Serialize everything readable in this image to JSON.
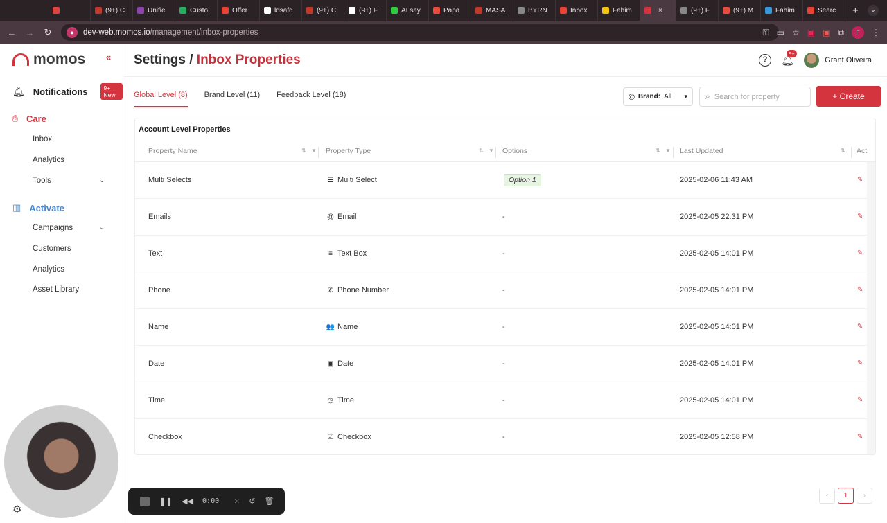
{
  "browser": {
    "tabs": [
      {
        "label": "",
        "color": "#e0443e"
      },
      {
        "label": "(9+) C",
        "color": "#c0392b"
      },
      {
        "label": "Unifie",
        "color": "#8e44ad"
      },
      {
        "label": "Custo",
        "color": "#27ae60"
      },
      {
        "label": "Offer",
        "color": "#ea4335"
      },
      {
        "label": "ldsafd",
        "color": "#ffffff"
      },
      {
        "label": "(9+) C",
        "color": "#c0392b"
      },
      {
        "label": "(9+) F",
        "color": "#ffffff"
      },
      {
        "label": "AI say",
        "color": "#2ecc40"
      },
      {
        "label": "Papa",
        "color": "#e74c3c"
      },
      {
        "label": "MASA",
        "color": "#c0392b"
      },
      {
        "label": "BYRN",
        "color": "#888888"
      },
      {
        "label": "Inbox",
        "color": "#ea4335"
      },
      {
        "label": "Fahim",
        "color": "#f1c40f"
      },
      {
        "label": "",
        "color": "#d4343d",
        "active": true
      },
      {
        "label": "(9+) F",
        "color": "#888888"
      },
      {
        "label": "(9+) M",
        "color": "#e74c3c"
      },
      {
        "label": "Fahim",
        "color": "#3498db"
      },
      {
        "label": "Searc",
        "color": "#ea4335"
      }
    ],
    "new_tab": "+",
    "url_host": "dev-web.momos.io",
    "url_path": "/management/inbox-properties",
    "profile_initial": "F"
  },
  "sidebar": {
    "brand": "momos",
    "collapse": "«",
    "notifications": {
      "label": "Notifications",
      "badge": "9+ New"
    },
    "care": {
      "label": "Care",
      "items": [
        "Inbox",
        "Analytics",
        "Tools"
      ]
    },
    "activate": {
      "label": "Activate",
      "items": [
        "Campaigns",
        "Customers",
        "Analytics",
        "Asset Library"
      ]
    }
  },
  "header": {
    "title_prefix": "Settings /",
    "title_accent": "Inbox Properties",
    "notif_count": "9+",
    "user_name": "Grant Oliveira"
  },
  "tabs": [
    {
      "label": "Global Level (8)",
      "selected": true
    },
    {
      "label": "Brand Level (11)",
      "selected": false
    },
    {
      "label": "Feedback Level (18)",
      "selected": false
    }
  ],
  "toolbar": {
    "brand_label": "Brand:",
    "brand_value": "All",
    "search_placeholder": "Search for property",
    "create_label": "+ Create"
  },
  "table": {
    "title": "Account Level Properties",
    "columns": [
      "Property Name",
      "Property Type",
      "Options",
      "Last Updated",
      "Act"
    ],
    "rows": [
      {
        "name": "Multi Selects",
        "type_icon": "☰",
        "type": "Multi Select",
        "options": "Option 1",
        "updated": "2025-02-06 11:43 AM"
      },
      {
        "name": "Emails",
        "type_icon": "@",
        "type": "Email",
        "options": "-",
        "updated": "2025-02-05 22:31 PM"
      },
      {
        "name": "Text",
        "type_icon": "≡",
        "type": "Text Box",
        "options": "-",
        "updated": "2025-02-05 14:01 PM"
      },
      {
        "name": "Phone",
        "type_icon": "✆",
        "type": "Phone Number",
        "options": "-",
        "updated": "2025-02-05 14:01 PM"
      },
      {
        "name": "Name",
        "type_icon": "👥",
        "type": "Name",
        "options": "-",
        "updated": "2025-02-05 14:01 PM"
      },
      {
        "name": "Date",
        "type_icon": "▣",
        "type": "Date",
        "options": "-",
        "updated": "2025-02-05 14:01 PM"
      },
      {
        "name": "Time",
        "type_icon": "◷",
        "type": "Time",
        "options": "-",
        "updated": "2025-02-05 14:01 PM"
      },
      {
        "name": "Checkbox",
        "type_icon": "☑",
        "type": "Checkbox",
        "options": "-",
        "updated": "2025-02-05 12:58 PM"
      }
    ]
  },
  "pagination": {
    "prev": "‹",
    "current": "1",
    "next": "›"
  },
  "recorder": {
    "time": "0:00"
  },
  "colors": {
    "brand": "#d4343d",
    "activate": "#4a8ad0",
    "chip": "#e8f4e4"
  }
}
